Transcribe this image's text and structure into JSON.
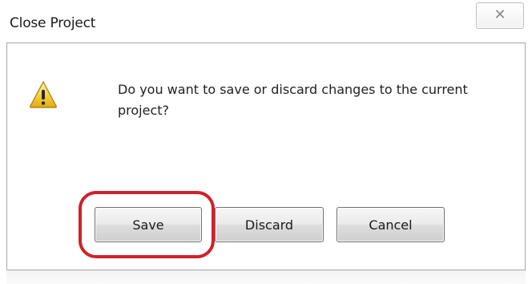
{
  "window": {
    "title": "Close Project",
    "close_icon": "close-icon"
  },
  "dialog": {
    "icon": "warning-icon",
    "message": "Do you want to save or discard changes to the current project?"
  },
  "buttons": {
    "save": "Save",
    "discard": "Discard",
    "cancel": "Cancel"
  },
  "annotation": {
    "highlight_color": "#d1202a"
  }
}
